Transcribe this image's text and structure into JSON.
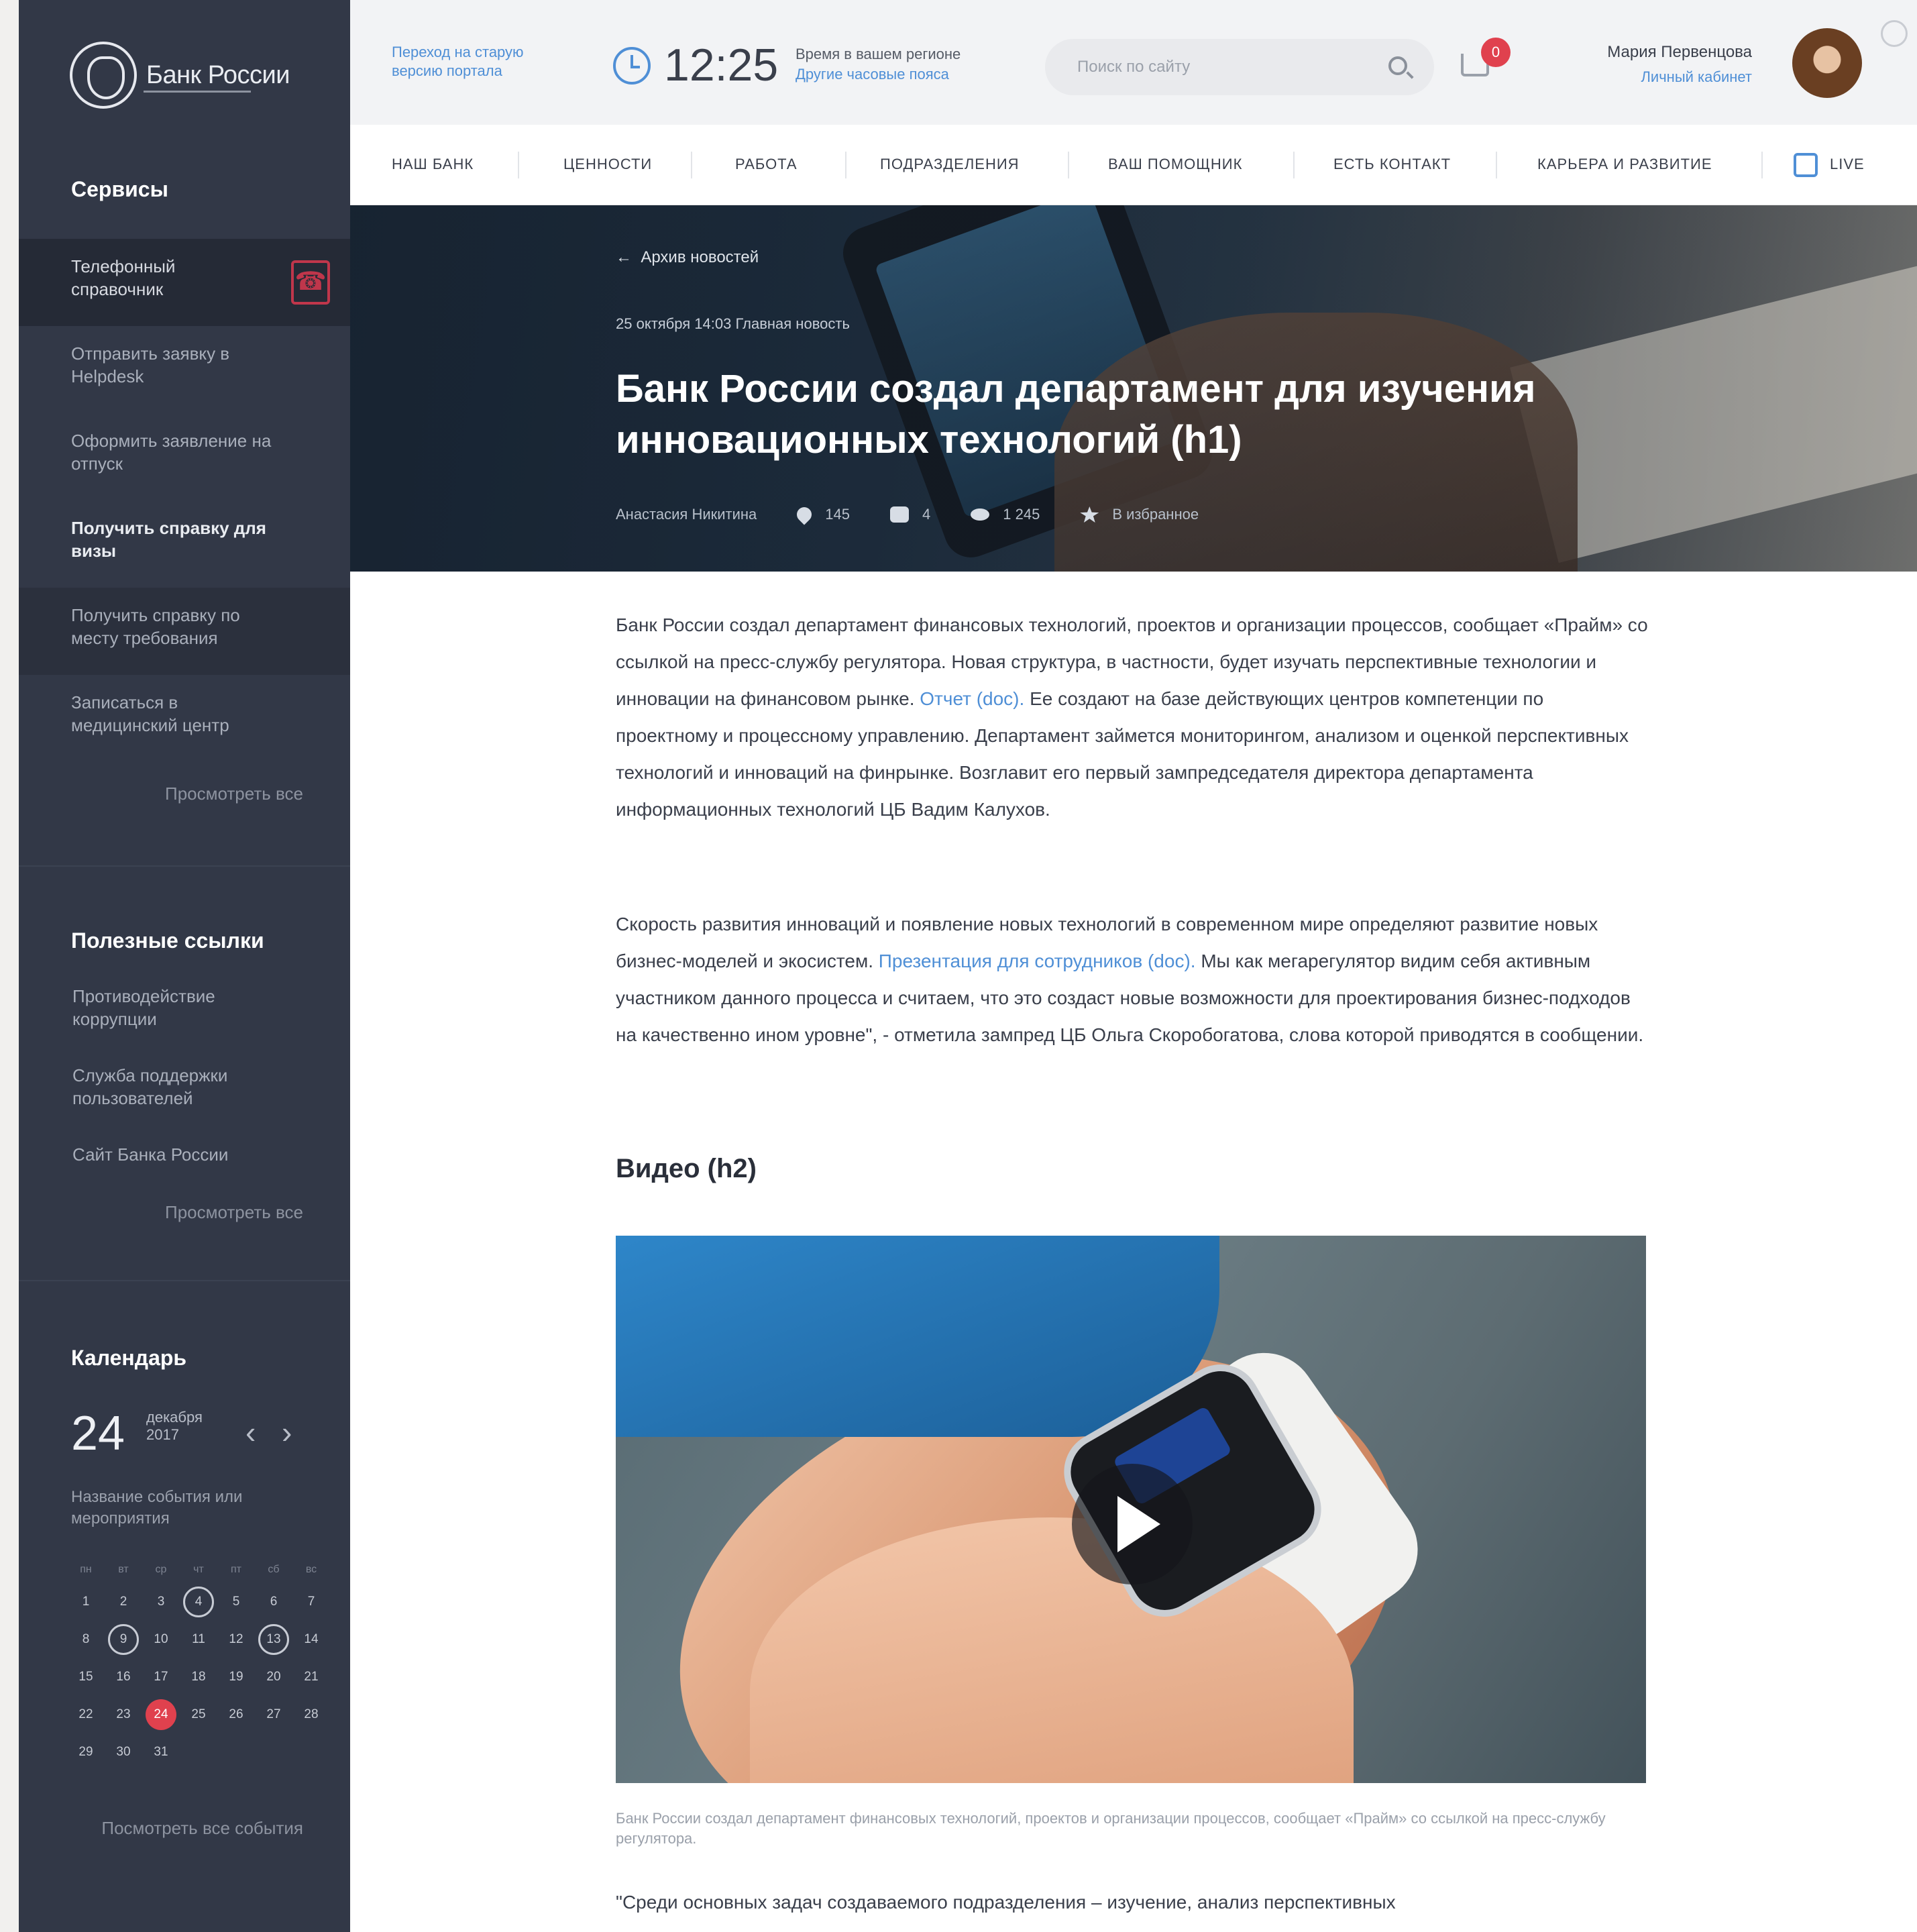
{
  "sidebar": {
    "logo_text": "Банк России",
    "services_title": "Сервисы",
    "services": [
      {
        "label": "Телефонный справочник"
      },
      {
        "label": "Отправить заявку в Helpdesk"
      },
      {
        "label": "Оформить заявление на отпуск"
      },
      {
        "label": "Получить справку для визы"
      },
      {
        "label": "Получить справку по месту требования"
      },
      {
        "label": "Записаться в медицинский центр"
      }
    ],
    "services_more": "Просмотреть все",
    "links_title": "Полезные ссылки",
    "links": [
      {
        "label": "Противодействие коррупции"
      },
      {
        "label": "Служба поддержки пользователей"
      },
      {
        "label": "Сайт Банка России"
      }
    ],
    "links_more": "Просмотреть все",
    "calendar": {
      "title": "Календарь",
      "day": "24",
      "month": "декабря",
      "year": "2017",
      "event": "Название события или мероприятия",
      "weekdays": [
        "пн",
        "вт",
        "ср",
        "чт",
        "пт",
        "сб",
        "вс"
      ],
      "days": [
        "1",
        "2",
        "3",
        "4",
        "5",
        "6",
        "7",
        "8",
        "9",
        "10",
        "11",
        "12",
        "13",
        "14",
        "15",
        "16",
        "17",
        "18",
        "19",
        "20",
        "21",
        "22",
        "23",
        "24",
        "25",
        "26",
        "27",
        "28",
        "29",
        "30",
        "31"
      ],
      "ringed_days": [
        "4",
        "9",
        "13"
      ],
      "today": "24",
      "all_events": "Посмотреть все события"
    }
  },
  "topbar": {
    "old_version": "Переход на старую версию портала",
    "time": "12:25",
    "weather_line1": "Время в вашем регионе",
    "weather_line2": "Другие часовые пояса",
    "search_placeholder": "Поиск по сайту",
    "cart_count": "0",
    "user_name": "Мария Первенцова",
    "user_link": "Личный кабинет"
  },
  "nav": {
    "items": [
      "Наш банк",
      "Ценности",
      "Работа",
      "Подразделения",
      "Ваш помощник",
      "Есть контакт",
      "Карьера и развитие"
    ],
    "live": "Live"
  },
  "hero": {
    "back_link": "Архив новостей",
    "date": "25 октября 14:03   Главная новость",
    "title": "Банк России создал департамент для изучения инновационных технологий (h1)",
    "author": "Анастасия Никитина",
    "likes": "145",
    "comments": "4",
    "views": "1 245",
    "favorite": "В избранное"
  },
  "article": {
    "p1": "Банк России создал департамент финансовых технологий, проектов и организации процессов, сообщает «Прайм» со ссылкой на пресс-службу регулятора. Новая структура, в частности, будет изучать перспективные технологии и инновации на финансовом рынке.",
    "p1_link": "Отчет (doc).",
    "p1_rest": "Ее создают на базе действующих центров компетенции по проектному и процессному управлению. Департамент займется мониторингом, анализом и оценкой перспективных технологий и инноваций на финрынке. Возглавит его первый зампредседателя директора департамента информационных технологий ЦБ Вадим Калухов.",
    "p2": "Скорость развития инноваций и появление новых технологий в современном мире определяют развитие новых бизнес-моделей и экосистем.",
    "p2_link": "Презентация для сотрудников (doc).",
    "p2_rest": "Мы как мегарегулятор видим себя активным участником данного процесса и считаем, что это создаст новые возможности для проектирования бизнес-подходов на качественно ином уровне\", - отметила зампред ЦБ Ольга Скоробогатова, слова которой приводятся в сообщении.",
    "h2": "Видео (h2)",
    "caption": "Банк России создал департамент финансовых технологий, проектов и организации процессов, сообщает «Прайм» со ссылкой на пресс-службу регулятора.",
    "quote": "\"Среди основных задач создаваемого подразделения – изучение, анализ перспективных"
  }
}
